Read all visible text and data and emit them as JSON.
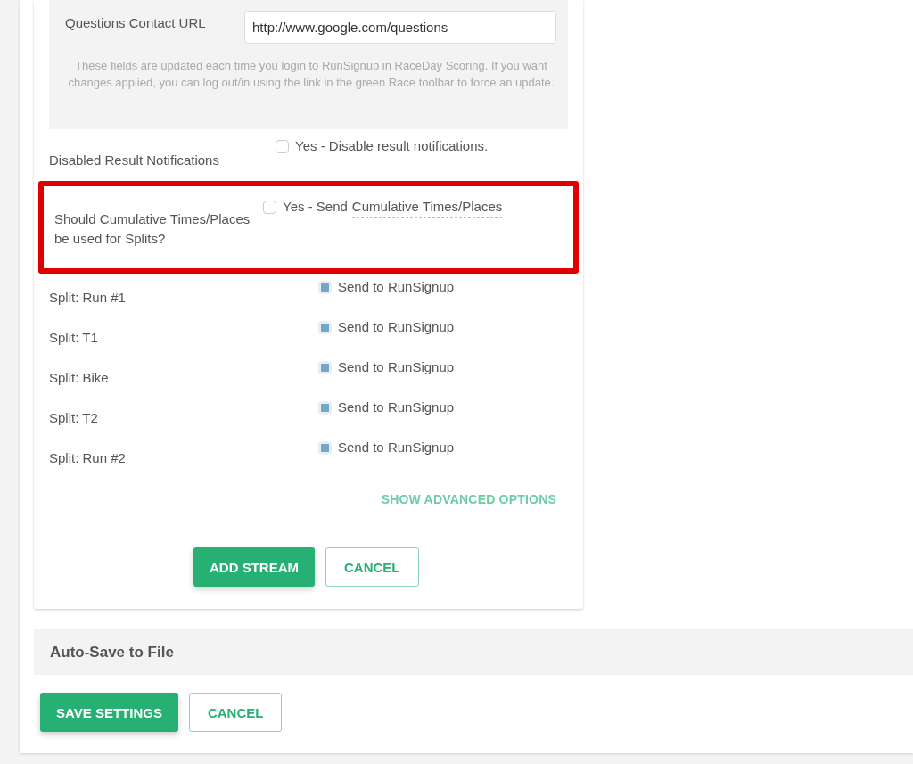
{
  "info_panel": {
    "field": {
      "label": "Questions Contact URL",
      "value": "http://www.google.com/questions"
    },
    "note": "These fields are updated each time you login to RunSignup in RaceDay Scoring. If you want changes applied, you can log out/in using the link in the green Race toolbar to force an update."
  },
  "settings": [
    {
      "kind": "option",
      "label": "Disabled Result Notifications",
      "option": "Yes - Disable result notifications.",
      "checked": false,
      "highlighted": false
    },
    {
      "kind": "option",
      "label": "Should Cumulative Times/Places be used for Splits?",
      "option": "Yes - Send",
      "link": "Cumulative Times/Places",
      "checked": false,
      "highlighted": true
    },
    {
      "kind": "split",
      "label": "Split: Run #1",
      "option": "Send to RunSignup",
      "checked": true,
      "highlighted": false
    },
    {
      "kind": "split",
      "label": "Split: T1",
      "option": "Send to RunSignup",
      "checked": true,
      "highlighted": false
    },
    {
      "kind": "split",
      "label": "Split: Bike",
      "option": "Send to RunSignup",
      "checked": true,
      "highlighted": false
    },
    {
      "kind": "split",
      "label": "Split: T2",
      "option": "Send to RunSignup",
      "checked": true,
      "highlighted": false
    },
    {
      "kind": "split",
      "label": "Split: Run #2",
      "option": "Send to RunSignup",
      "checked": true,
      "highlighted": false
    }
  ],
  "advanced_link": "SHOW ADVANCED OPTIONS",
  "stream_buttons": {
    "primary": "ADD STREAM",
    "secondary": "CANCEL"
  },
  "section": {
    "title": "Auto-Save to File"
  },
  "page_buttons": {
    "primary": "SAVE SETTINGS",
    "secondary": "CANCEL"
  }
}
